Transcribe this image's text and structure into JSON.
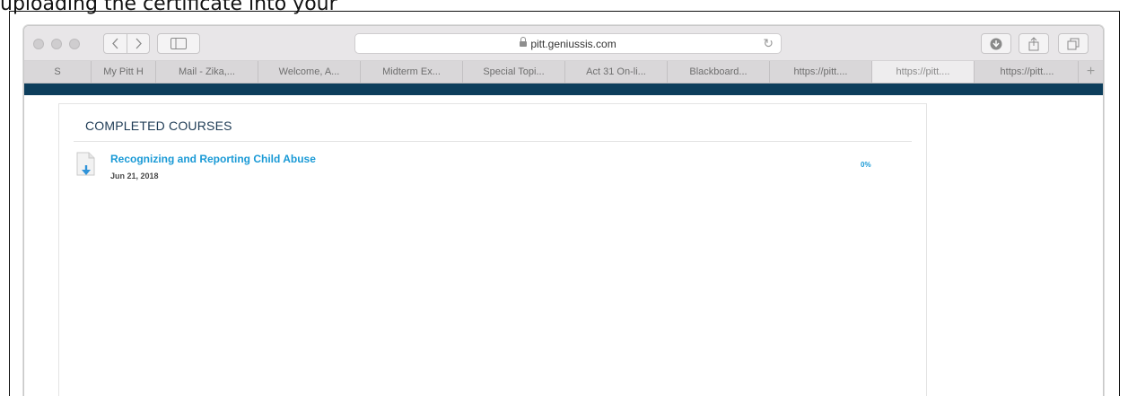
{
  "outer": {
    "caption": "uploading the certificate into your"
  },
  "browser": {
    "address": "pitt.geniussis.com",
    "tabs": [
      {
        "label": "S",
        "active": false
      },
      {
        "label": "My Pitt H",
        "active": false
      },
      {
        "label": "Mail - Zika,...",
        "active": false
      },
      {
        "label": "Welcome, A...",
        "active": false
      },
      {
        "label": "Midterm Ex...",
        "active": false
      },
      {
        "label": "Special Topi...",
        "active": false
      },
      {
        "label": "Act 31 On-li...",
        "active": false
      },
      {
        "label": "Blackboard...",
        "active": false
      },
      {
        "label": "https://pitt....",
        "active": false
      },
      {
        "label": "https://pitt....",
        "active": true
      },
      {
        "label": "https://pitt....",
        "active": false
      }
    ],
    "new_tab_glyph": "+"
  },
  "page": {
    "section_title": "COMPLETED COURSES",
    "courses": [
      {
        "title": "Recognizing and Reporting Child Abuse",
        "date": "Jun 21, 2018",
        "progress": "0%",
        "icon": "download-document-icon"
      }
    ]
  },
  "colors": {
    "site_band": "#0d3e5c",
    "link_blue": "#1a9ad6",
    "title_navy": "#1e3b55"
  }
}
